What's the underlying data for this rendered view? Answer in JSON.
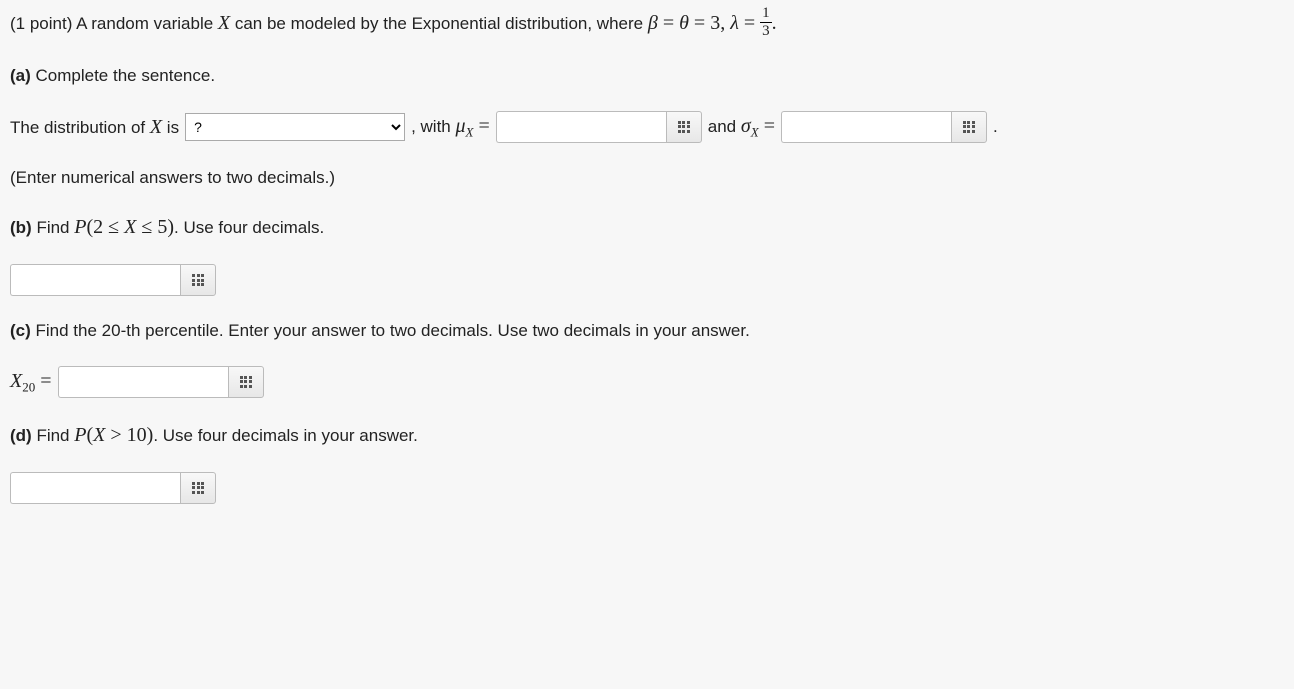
{
  "intro": {
    "points_prefix": "(1 point) A random variable ",
    "var": "X",
    "after_var": " can be modeled by the Exponential distribution, where ",
    "beta": "β",
    "eq1": " = ",
    "theta": "θ",
    "eq2": " = ",
    "three": "3, ",
    "lambda": "λ",
    "eq3": " = ",
    "frac_num": "1",
    "frac_den": "3",
    "end": "."
  },
  "partA": {
    "label": "(a)",
    "text": " Complete the sentence.",
    "sentence_pre": "The distribution of ",
    "var": "X",
    "sentence_mid": " is ",
    "select_placeholder": "?",
    "after_select": ", with ",
    "mu": "μ",
    "sub": "X",
    "eq": " = ",
    "and_text": "   and ",
    "sigma": "σ",
    "period": " .",
    "hint": "(Enter numerical answers to two decimals.)"
  },
  "partB": {
    "label": "(b)",
    "text_pre": " Find ",
    "P": "P",
    "paren_open": "(",
    "two": "2 ",
    "le1": "≤ ",
    "X": "X ",
    "le2": "≤ ",
    "five": "5",
    "paren_close": ")",
    "text_post": ". Use four decimals."
  },
  "partC": {
    "label": "(c)",
    "text": " Find the 20-th percentile. Enter your answer to two decimals. Use two decimals in your answer.",
    "X": "X",
    "sub": "20",
    "eq": " = "
  },
  "partD": {
    "label": "(d)",
    "text_pre": " Find ",
    "P": "P",
    "paren_open": "(",
    "X": "X ",
    "gt": "> ",
    "ten": "10",
    "paren_close": ")",
    "text_post": ". Use four decimals in your answer."
  }
}
